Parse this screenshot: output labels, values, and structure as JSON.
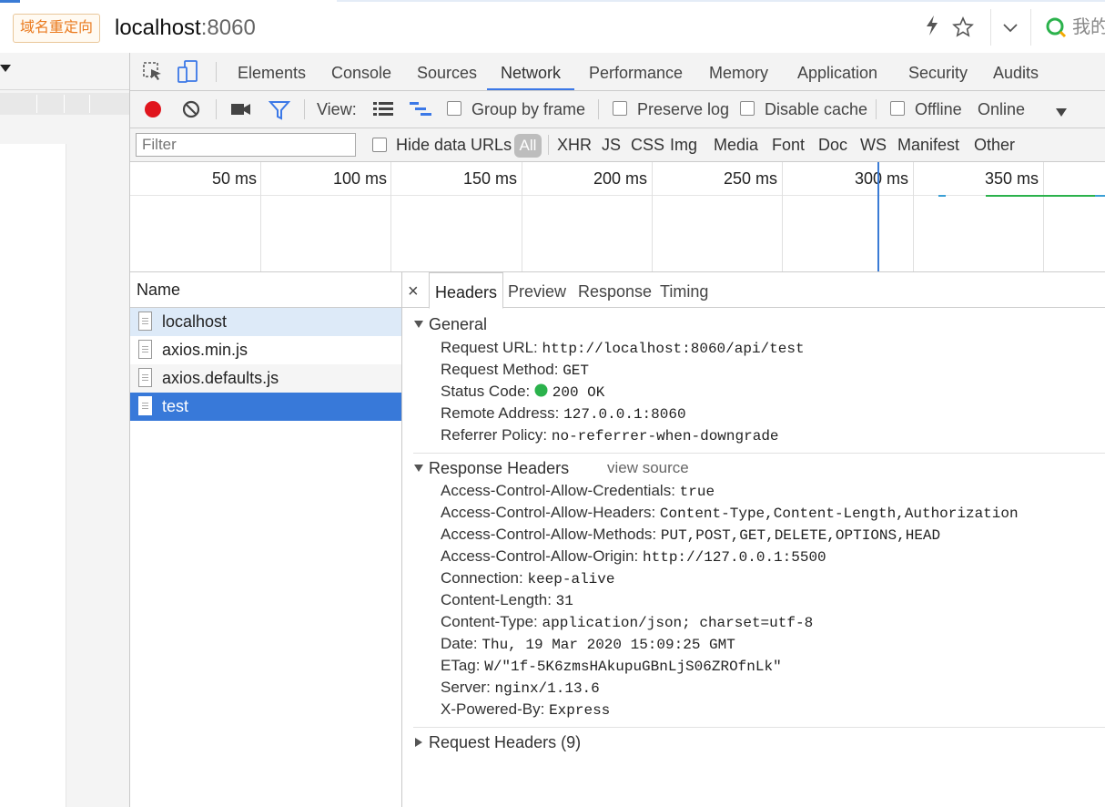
{
  "address_bar": {
    "redirect_badge": "域名重定向",
    "host": "localhost",
    "port": ":8060",
    "right_text": "我的"
  },
  "devtools": {
    "tabs": [
      "Elements",
      "Console",
      "Sources",
      "Network",
      "Performance",
      "Memory",
      "Application",
      "Security",
      "Audits"
    ],
    "active_tab": "Network",
    "toolbar": {
      "view_label": "View:",
      "group_by_frame": "Group by frame",
      "preserve_log": "Preserve log",
      "disable_cache": "Disable cache",
      "offline": "Offline",
      "throttle": "Online"
    },
    "filter": {
      "placeholder": "Filter",
      "hide_data_urls": "Hide data URLs",
      "types": [
        "All",
        "XHR",
        "JS",
        "CSS",
        "Img",
        "Media",
        "Font",
        "Doc",
        "WS",
        "Manifest",
        "Other"
      ]
    },
    "timeline": {
      "ticks": [
        "50 ms",
        "100 ms",
        "150 ms",
        "200 ms",
        "250 ms",
        "300 ms",
        "350 ms"
      ]
    },
    "requests": {
      "header": "Name",
      "items": [
        "localhost",
        "axios.min.js",
        "axios.defaults.js",
        "test"
      ],
      "selected": "test"
    },
    "details": {
      "close": "×",
      "tabs": [
        "Headers",
        "Preview",
        "Response",
        "Timing"
      ],
      "active_tab": "Headers",
      "general_title": "General",
      "general": [
        {
          "k": "Request URL:",
          "v": "http://localhost:8060/api/test"
        },
        {
          "k": "Request Method:",
          "v": "GET"
        },
        {
          "k": "Status Code:",
          "v": "200 OK"
        },
        {
          "k": "Remote Address:",
          "v": "127.0.0.1:8060"
        },
        {
          "k": "Referrer Policy:",
          "v": "no-referrer-when-downgrade"
        }
      ],
      "response_title": "Response Headers",
      "view_source": "view source",
      "response_headers": [
        {
          "k": "Access-Control-Allow-Credentials:",
          "v": "true"
        },
        {
          "k": "Access-Control-Allow-Headers:",
          "v": "Content-Type,Content-Length,Authorization"
        },
        {
          "k": "Access-Control-Allow-Methods:",
          "v": "PUT,POST,GET,DELETE,OPTIONS,HEAD"
        },
        {
          "k": "Access-Control-Allow-Origin:",
          "v": "http://127.0.0.1:5500"
        },
        {
          "k": "Connection:",
          "v": "keep-alive"
        },
        {
          "k": "Content-Length:",
          "v": "31"
        },
        {
          "k": "Content-Type:",
          "v": "application/json; charset=utf-8"
        },
        {
          "k": "Date:",
          "v": "Thu, 19 Mar 2020 15:09:25 GMT"
        },
        {
          "k": "ETag:",
          "v": "W/\"1f-5K6zmsHAkupuGBnLjS06ZROfnLk\""
        },
        {
          "k": "Server:",
          "v": "nginx/1.13.6"
        },
        {
          "k": "X-Powered-By:",
          "v": "Express"
        }
      ],
      "request_headers_title": "Request Headers (9)"
    }
  }
}
